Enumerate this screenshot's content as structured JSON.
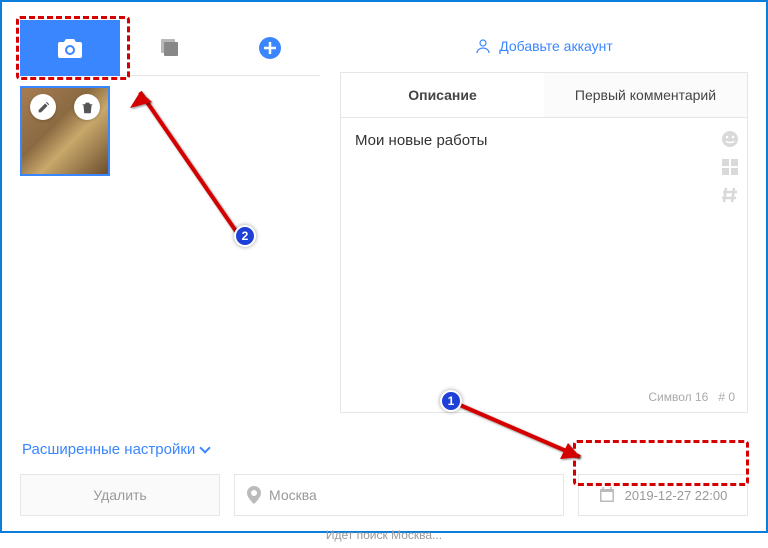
{
  "tabs": {
    "camera": "camera",
    "stack": "stack",
    "add": "add"
  },
  "account": {
    "label": "Добавьте аккаунт"
  },
  "descTabs": {
    "description": "Описание",
    "firstComment": "Первый комментарий"
  },
  "description": {
    "text": "Мои новые работы"
  },
  "counter": {
    "symbols": "Символ 16",
    "hash": "# 0"
  },
  "advanced": {
    "label": "Расширенные настройки"
  },
  "bottom": {
    "delete": "Удалить",
    "location": "Москва",
    "datetime": "2019-12-27 22:00"
  },
  "status": {
    "text": "Идет поиск Москва..."
  },
  "badges": {
    "b1": "1",
    "b2": "2"
  }
}
